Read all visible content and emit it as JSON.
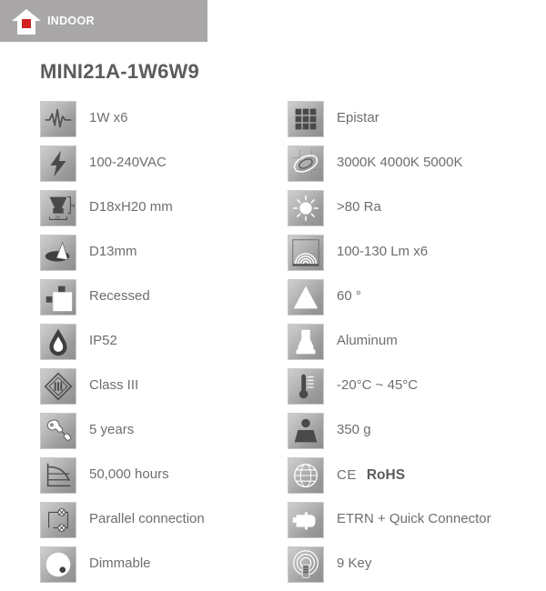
{
  "banner": {
    "label": "INDOOR",
    "icon": "house-icon",
    "background_color": "#a9a7a7",
    "house_color": "#ffffff",
    "accent_color": "#d32020"
  },
  "title": "MINI21A-1W6W9",
  "specs": {
    "left": [
      {
        "icon": "power-waveform-icon",
        "label": "1W x6"
      },
      {
        "icon": "lightning-bolt-icon",
        "label": "100-240VAC"
      },
      {
        "icon": "dimension-diagram-icon",
        "label": "D18xH20 mm"
      },
      {
        "icon": "cutout-hole-icon",
        "label": "D13mm"
      },
      {
        "icon": "recessed-mounting-icon",
        "label": "Recessed"
      },
      {
        "icon": "water-droplet-icon",
        "label": "IP52"
      },
      {
        "icon": "safety-class-diamond-icon",
        "label": "Class III"
      },
      {
        "icon": "wrench-warranty-icon",
        "label": "5 years"
      },
      {
        "icon": "lifespan-graph-icon",
        "label": "50,000 hours"
      },
      {
        "icon": "parallel-circuit-icon",
        "label": "Parallel connection"
      },
      {
        "icon": "dimmer-knob-icon",
        "label": "Dimmable"
      }
    ],
    "right": [
      {
        "icon": "led-chip-grid-icon",
        "label": "Epistar"
      },
      {
        "icon": "color-temperature-icon",
        "label": "3000K 4000K 5000K"
      },
      {
        "icon": "sun-cri-icon",
        "label": ">80 Ra"
      },
      {
        "icon": "luminous-flux-icon",
        "label": "100-130 Lm x6"
      },
      {
        "icon": "beam-angle-icon",
        "label": "60 °"
      },
      {
        "icon": "material-body-icon",
        "label": "Aluminum"
      },
      {
        "icon": "thermometer-icon",
        "label": "-20°C ~ 45°C"
      },
      {
        "icon": "weight-icon",
        "label": "350 g"
      },
      {
        "icon": "globe-certification-icon",
        "label": "",
        "ce": "CE",
        "rohs": "RoHS"
      },
      {
        "icon": "power-plug-icon",
        "label": "ETRN + Quick Connector"
      },
      {
        "icon": "remote-control-icon",
        "label": "9 Key"
      }
    ]
  }
}
